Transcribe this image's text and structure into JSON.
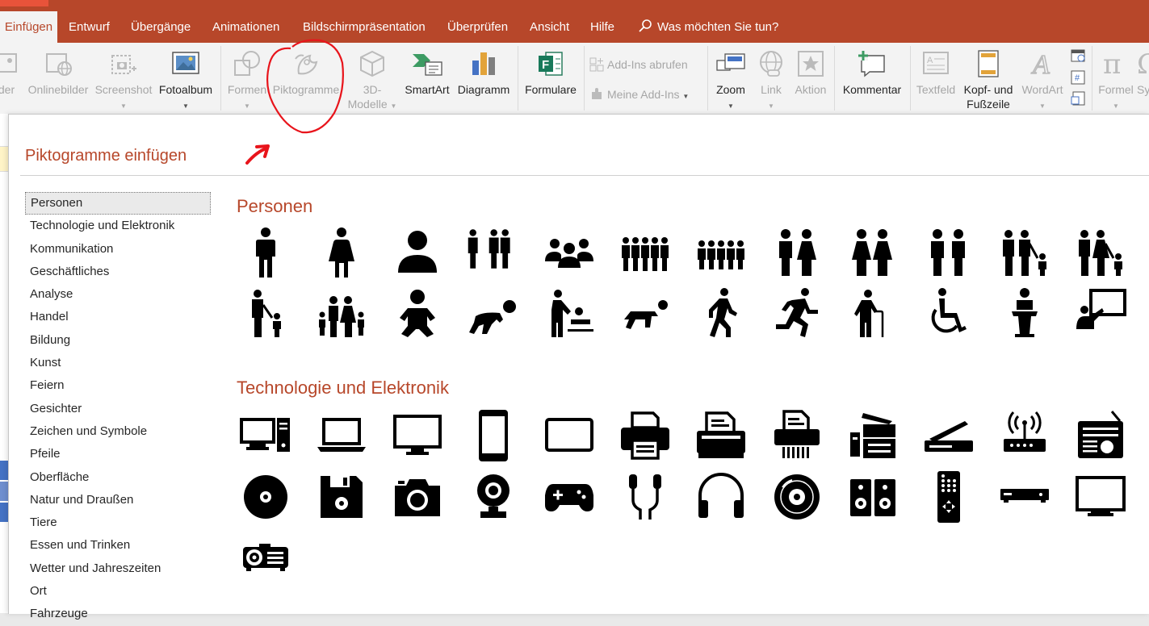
{
  "tabs": [
    {
      "label": "Einfügen",
      "active": true
    },
    {
      "label": "Entwurf"
    },
    {
      "label": "Übergänge"
    },
    {
      "label": "Animationen"
    },
    {
      "label": "Bildschirmpräsentation"
    },
    {
      "label": "Überprüfen"
    },
    {
      "label": "Ansicht"
    },
    {
      "label": "Hilfe"
    }
  ],
  "tell_me": "Was möchten Sie tun?",
  "ribbon": {
    "bilder": "der",
    "onlinebilder": "Onlinebilder",
    "screenshot": "Screenshot",
    "fotoalbum": "Fotoalbum",
    "formen": "Formen",
    "piktogramme": "Piktogramme",
    "modelle_1": "3D-",
    "modelle_2": "Modelle",
    "smartart": "SmartArt",
    "diagramm": "Diagramm",
    "formulare": "Formulare",
    "addins_abrufen": "Add-Ins abrufen",
    "meine_addins": "Meine Add-Ins",
    "zoom": "Zoom",
    "link": "Link",
    "aktion": "Aktion",
    "kommentar": "Kommentar",
    "textfeld": "Textfeld",
    "kopf_1": "Kopf- und",
    "kopf_2": "Fußzeile",
    "wordart": "WordArt",
    "formel": "Formel",
    "symbol": "Sy"
  },
  "dialog": {
    "title": "Piktogramme einfügen",
    "categories": [
      "Personen",
      "Technologie und Elektronik",
      "Kommunikation",
      "Geschäftliches",
      "Analyse",
      "Handel",
      "Bildung",
      "Kunst",
      "Feiern",
      "Gesichter",
      "Zeichen und Symbole",
      "Pfeile",
      "Oberfläche",
      "Natur und Draußen",
      "Tiere",
      "Essen und Trinken",
      "Wetter und Jahreszeiten",
      "Ort",
      "Fahrzeuge"
    ],
    "selected_category": "Personen",
    "sections": {
      "personen": "Personen",
      "technologie": "Technologie und Elektronik"
    }
  },
  "colors": {
    "accent": "#b7472a",
    "annotation": "#e8141b"
  }
}
